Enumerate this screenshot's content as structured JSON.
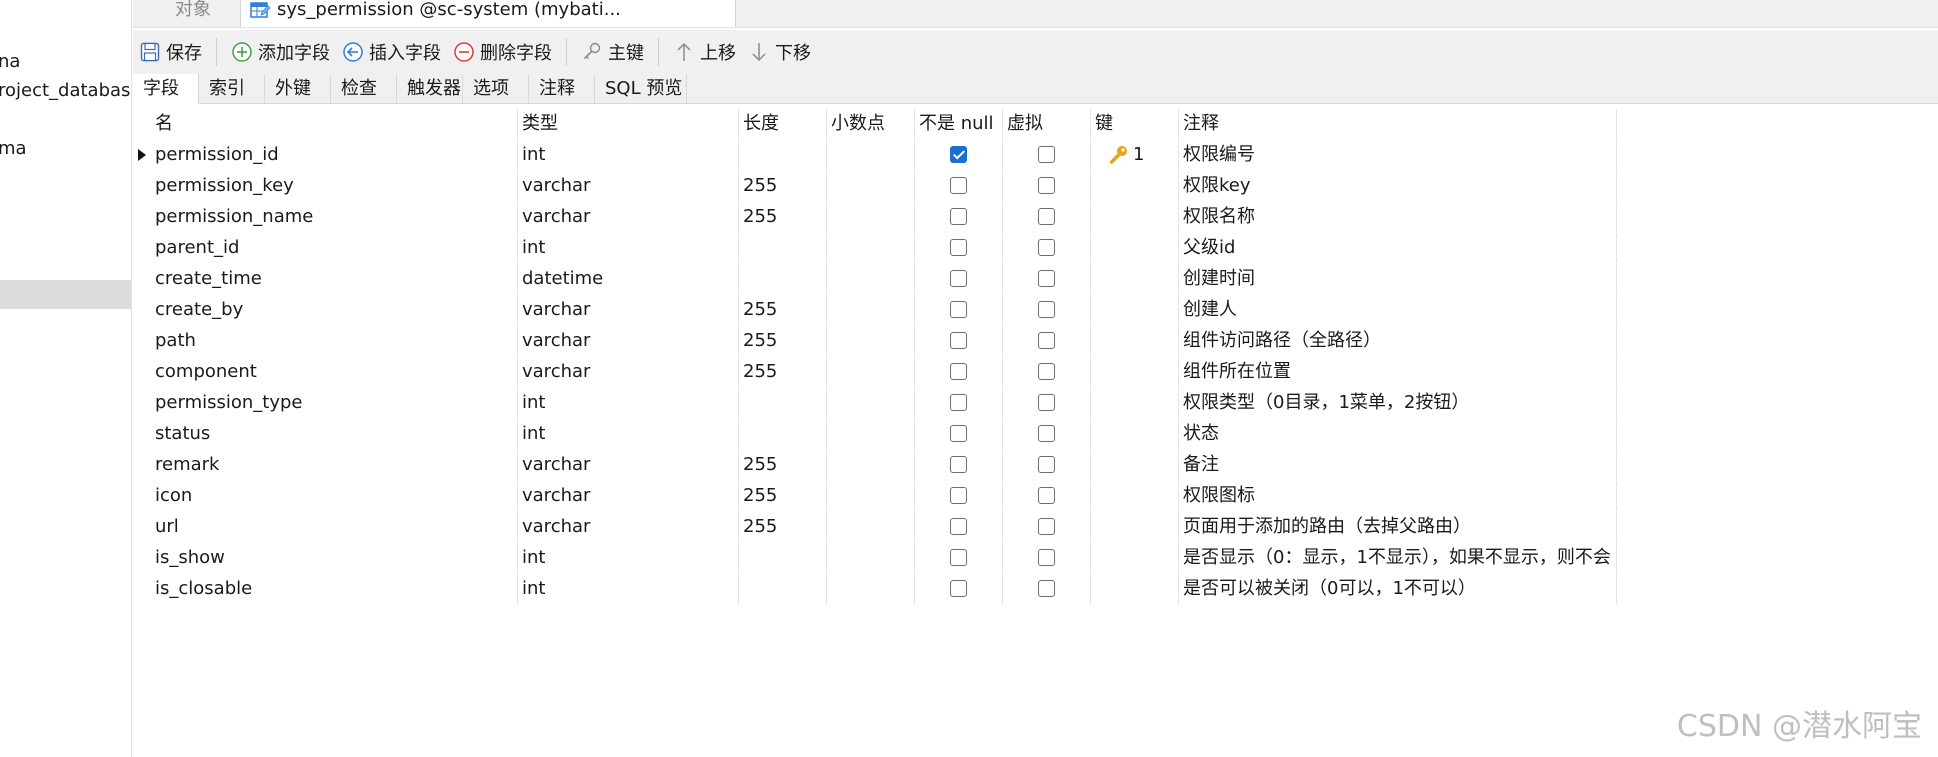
{
  "left_tree": {
    "items": [
      "na",
      "roject_database",
      "ma"
    ]
  },
  "tabs": {
    "objects": "对象",
    "table_editor": "sys_permission @sc-system (mybati..."
  },
  "toolbar": {
    "save": "保存",
    "add_field": "添加字段",
    "insert_field": "插入字段",
    "delete_field": "删除字段",
    "primary_key": "主键",
    "move_up": "上移",
    "move_down": "下移"
  },
  "sub_tabs": [
    "字段",
    "索引",
    "外键",
    "检查",
    "触发器",
    "选项",
    "注释",
    "SQL 预览"
  ],
  "grid": {
    "headers": {
      "name": "名",
      "type": "类型",
      "length": "长度",
      "decimal": "小数点",
      "not_null": "不是 null",
      "virtual": "虚拟",
      "key": "键",
      "comment": "注释"
    },
    "rows": [
      {
        "name": "permission_id",
        "type": "int",
        "length": "",
        "not_null": true,
        "virtual": false,
        "key": "1",
        "comment": "权限编号"
      },
      {
        "name": "permission_key",
        "type": "varchar",
        "length": "255",
        "not_null": false,
        "virtual": false,
        "key": "",
        "comment": "权限key"
      },
      {
        "name": "permission_name",
        "type": "varchar",
        "length": "255",
        "not_null": false,
        "virtual": false,
        "key": "",
        "comment": "权限名称"
      },
      {
        "name": "parent_id",
        "type": "int",
        "length": "",
        "not_null": false,
        "virtual": false,
        "key": "",
        "comment": "父级id"
      },
      {
        "name": "create_time",
        "type": "datetime",
        "length": "",
        "not_null": false,
        "virtual": false,
        "key": "",
        "comment": "创建时间"
      },
      {
        "name": "create_by",
        "type": "varchar",
        "length": "255",
        "not_null": false,
        "virtual": false,
        "key": "",
        "comment": "创建人"
      },
      {
        "name": "path",
        "type": "varchar",
        "length": "255",
        "not_null": false,
        "virtual": false,
        "key": "",
        "comment": "组件访问路径（全路径）"
      },
      {
        "name": "component",
        "type": "varchar",
        "length": "255",
        "not_null": false,
        "virtual": false,
        "key": "",
        "comment": "组件所在位置"
      },
      {
        "name": "permission_type",
        "type": "int",
        "length": "",
        "not_null": false,
        "virtual": false,
        "key": "",
        "comment": "权限类型（0目录，1菜单，2按钮）"
      },
      {
        "name": "status",
        "type": "int",
        "length": "",
        "not_null": false,
        "virtual": false,
        "key": "",
        "comment": "状态"
      },
      {
        "name": "remark",
        "type": "varchar",
        "length": "255",
        "not_null": false,
        "virtual": false,
        "key": "",
        "comment": "备注"
      },
      {
        "name": "icon",
        "type": "varchar",
        "length": "255",
        "not_null": false,
        "virtual": false,
        "key": "",
        "comment": "权限图标"
      },
      {
        "name": "url",
        "type": "varchar",
        "length": "255",
        "not_null": false,
        "virtual": false,
        "key": "",
        "comment": "页面用于添加的路由（去掉父路由）"
      },
      {
        "name": "is_show",
        "type": "int",
        "length": "",
        "not_null": false,
        "virtual": false,
        "key": "",
        "comment": "是否显示（0：显示，1不显示），如果不显示，则不会"
      },
      {
        "name": "is_closable",
        "type": "int",
        "length": "",
        "not_null": false,
        "virtual": false,
        "key": "",
        "comment": "是否可以被关闭（0可以，1不可以）"
      }
    ]
  },
  "watermark": "CSDN @潜水阿宝",
  "colors": {
    "accent": "#1a6fd1",
    "key_icon": "#e8a317"
  },
  "icons": {
    "save": "save-icon",
    "add": "add-circle-icon",
    "insert": "insert-arrow-icon",
    "delete": "remove-circle-icon",
    "key": "key-icon",
    "up": "arrow-up-icon",
    "down": "arrow-down-icon",
    "table": "table-icon"
  }
}
